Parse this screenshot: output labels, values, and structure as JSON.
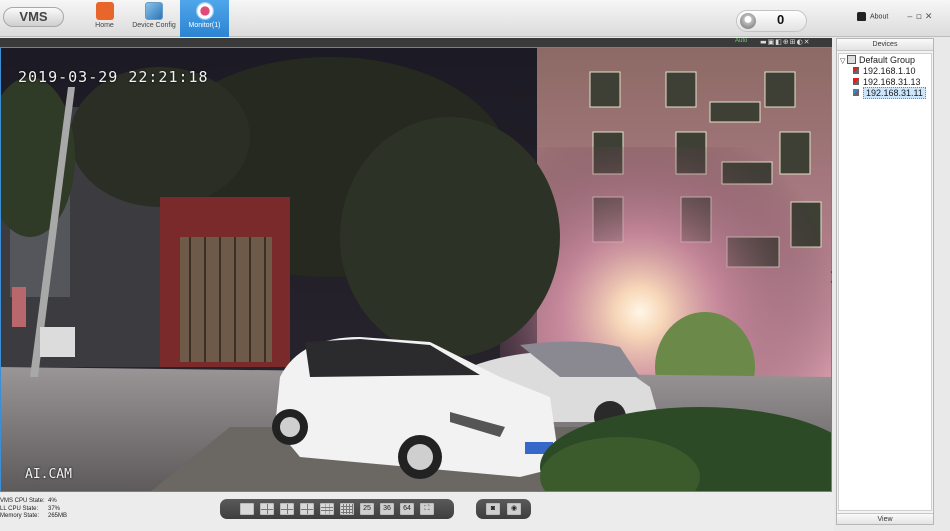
{
  "app": {
    "logo": "VMS"
  },
  "nav": {
    "home": "Home",
    "device_config": "Device Config",
    "monitor": "Monitor(1)"
  },
  "alarm": {
    "count": "0"
  },
  "about": "About",
  "video": {
    "audio_label": "Auto",
    "toolbar_icons": "▬▣◧⊕⊞◐✕",
    "osd_time": "2019-03-29 22:21:18",
    "osd_name": "AI.CAM",
    "expand_arrow": "❯"
  },
  "panel": {
    "header": "Devices",
    "footer": "View",
    "group": {
      "toggle": "▽",
      "label": "Default Group"
    },
    "devices": [
      {
        "ip": "192.168.1.10",
        "online": false
      },
      {
        "ip": "192.168.31.13",
        "online": false
      },
      {
        "ip": "192.168.31.11",
        "online": true,
        "selected": true
      }
    ]
  },
  "stats": {
    "vms_cpu_label": "VMS CPU State:",
    "vms_cpu_value": "4%",
    "ll_cpu_label": "LL CPU State:",
    "ll_cpu_value": "37%",
    "memory_label": "Memory State:",
    "memory_value": "265MB"
  },
  "layout_buttons": [
    "1",
    "4",
    "6",
    "8",
    "9",
    "16",
    "25",
    "36",
    "64",
    "full"
  ],
  "layout_text": {
    "b25": "25",
    "b36": "36",
    "b64": "64",
    "full": "⛶"
  },
  "snap_buttons": {
    "snapshot": "◙",
    "record": "◉"
  },
  "window_controls": "‒▫✕"
}
